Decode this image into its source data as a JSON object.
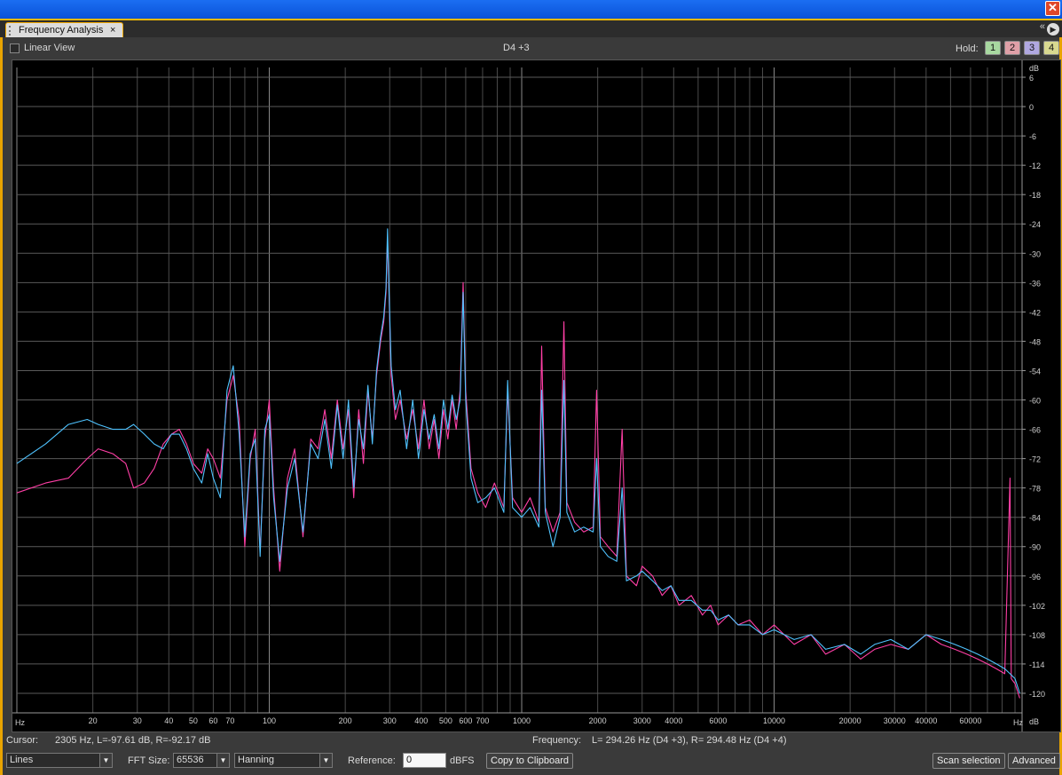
{
  "window": {
    "close_glyph": "✕"
  },
  "tab": {
    "title": "Frequency Analysis",
    "close_glyph": "×",
    "menu_glyph": "▶",
    "overflow_glyph": "«"
  },
  "topbar": {
    "linear_view_label": "Linear View",
    "linear_view_checked": false,
    "note": "D4 +3",
    "hold_label": "Hold:",
    "hold_buttons": [
      {
        "label": "1",
        "color": "#a8d8a0"
      },
      {
        "label": "2",
        "color": "#e0a0a8"
      },
      {
        "label": "3",
        "color": "#b0a8e0"
      },
      {
        "label": "4",
        "color": "#d8d890"
      }
    ]
  },
  "status": {
    "cursor_label": "Cursor:",
    "cursor_value": "2305 Hz, L=-97.61 dB, R=-92.17 dB",
    "frequency_label": "Frequency:",
    "frequency_value": "L= 294.26 Hz (D4 +3), R= 294.48 Hz (D4 +4)"
  },
  "controls": {
    "plot_style": "Lines",
    "fft_size_label": "FFT Size:",
    "fft_size": "65536",
    "window_func": "Hanning",
    "reference_label": "Reference:",
    "reference_value": "0",
    "reference_unit": "dBFS",
    "copy_button": "Copy to Clipboard",
    "scan_button": "Scan selection",
    "advanced_button": "Advanced"
  },
  "chart_data": {
    "type": "line",
    "x_scale": "log",
    "xlim": [
      10,
      96000
    ],
    "ylim": [
      -124,
      8
    ],
    "x_tick_labels": [
      {
        "value": 20,
        "label": "20",
        "major": false
      },
      {
        "value": 30,
        "label": "30",
        "major": false
      },
      {
        "value": 40,
        "label": "40",
        "major": false
      },
      {
        "value": 50,
        "label": "50",
        "major": false
      },
      {
        "value": 60,
        "label": "60",
        "major": false
      },
      {
        "value": 70,
        "label": "70",
        "major": false
      },
      {
        "value": 100,
        "label": "100",
        "major": true
      },
      {
        "value": 200,
        "label": "200",
        "major": false
      },
      {
        "value": 300,
        "label": "300",
        "major": false
      },
      {
        "value": 400,
        "label": "400",
        "major": false
      },
      {
        "value": 500,
        "label": "500",
        "major": false
      },
      {
        "value": 600,
        "label": "600",
        "major": false
      },
      {
        "value": 700,
        "label": "700",
        "major": false
      },
      {
        "value": 1000,
        "label": "1000",
        "major": true
      },
      {
        "value": 2000,
        "label": "2000",
        "major": false
      },
      {
        "value": 3000,
        "label": "3000",
        "major": false
      },
      {
        "value": 4000,
        "label": "4000",
        "major": false
      },
      {
        "value": 6000,
        "label": "6000",
        "major": false
      },
      {
        "value": 10000,
        "label": "10000",
        "major": true
      },
      {
        "value": 20000,
        "label": "20000",
        "major": false
      },
      {
        "value": 30000,
        "label": "30000",
        "major": false
      },
      {
        "value": 40000,
        "label": "40000",
        "major": false
      },
      {
        "value": 60000,
        "label": "60000",
        "major": false
      }
    ],
    "x_unit_left": "Hz",
    "x_unit_right": "Hz",
    "y_unit_top": "dB",
    "y_unit_bottom": "dB",
    "y_ticks": [
      6,
      0,
      -6,
      -12,
      -18,
      -24,
      -30,
      -36,
      -42,
      -48,
      -54,
      -60,
      -66,
      -72,
      -78,
      -84,
      -90,
      -96,
      -102,
      -108,
      -114,
      -120
    ],
    "grid": true,
    "series": [
      {
        "color": "#ff3fa6",
        "points": [
          [
            10,
            -79
          ],
          [
            13,
            -77
          ],
          [
            16,
            -76
          ],
          [
            19,
            -72
          ],
          [
            21,
            -70
          ],
          [
            24,
            -71
          ],
          [
            27,
            -73
          ],
          [
            29,
            -78
          ],
          [
            32,
            -77
          ],
          [
            35,
            -74
          ],
          [
            38,
            -69
          ],
          [
            41,
            -67
          ],
          [
            44,
            -66
          ],
          [
            47,
            -69
          ],
          [
            50,
            -73
          ],
          [
            54,
            -75
          ],
          [
            57,
            -70
          ],
          [
            60,
            -72
          ],
          [
            64,
            -76
          ],
          [
            68,
            -60
          ],
          [
            72,
            -55
          ],
          [
            76,
            -64
          ],
          [
            80,
            -90
          ],
          [
            84,
            -72
          ],
          [
            88,
            -66
          ],
          [
            92,
            -91
          ],
          [
            96,
            -68
          ],
          [
            100,
            -60
          ],
          [
            104,
            -78
          ],
          [
            110,
            -95
          ],
          [
            118,
            -76
          ],
          [
            126,
            -70
          ],
          [
            136,
            -88
          ],
          [
            146,
            -68
          ],
          [
            156,
            -70
          ],
          [
            166,
            -62
          ],
          [
            176,
            -72
          ],
          [
            186,
            -60
          ],
          [
            196,
            -70
          ],
          [
            206,
            -62
          ],
          [
            216,
            -80
          ],
          [
            226,
            -62
          ],
          [
            236,
            -73
          ],
          [
            246,
            -58
          ],
          [
            256,
            -68
          ],
          [
            266,
            -55
          ],
          [
            276,
            -48
          ],
          [
            284,
            -44
          ],
          [
            290,
            -38
          ],
          [
            294,
            -27
          ],
          [
            298,
            -38
          ],
          [
            304,
            -55
          ],
          [
            316,
            -64
          ],
          [
            330,
            -60
          ],
          [
            350,
            -68
          ],
          [
            370,
            -62
          ],
          [
            390,
            -70
          ],
          [
            410,
            -60
          ],
          [
            430,
            -70
          ],
          [
            450,
            -64
          ],
          [
            470,
            -72
          ],
          [
            490,
            -62
          ],
          [
            510,
            -68
          ],
          [
            530,
            -60
          ],
          [
            550,
            -66
          ],
          [
            570,
            -58
          ],
          [
            586,
            -36
          ],
          [
            600,
            -58
          ],
          [
            630,
            -74
          ],
          [
            670,
            -79
          ],
          [
            720,
            -82
          ],
          [
            780,
            -77
          ],
          [
            850,
            -82
          ],
          [
            880,
            -58
          ],
          [
            920,
            -80
          ],
          [
            1000,
            -83
          ],
          [
            1080,
            -80
          ],
          [
            1170,
            -85
          ],
          [
            1200,
            -49
          ],
          [
            1240,
            -82
          ],
          [
            1330,
            -87
          ],
          [
            1420,
            -83
          ],
          [
            1470,
            -44
          ],
          [
            1510,
            -81
          ],
          [
            1620,
            -85
          ],
          [
            1760,
            -87
          ],
          [
            1920,
            -86
          ],
          [
            1980,
            -58
          ],
          [
            2050,
            -88
          ],
          [
            2200,
            -90
          ],
          [
            2380,
            -92
          ],
          [
            2500,
            -66
          ],
          [
            2600,
            -96
          ],
          [
            2850,
            -98
          ],
          [
            3000,
            -94
          ],
          [
            3300,
            -96
          ],
          [
            3600,
            -100
          ],
          [
            3900,
            -98
          ],
          [
            4200,
            -102
          ],
          [
            4700,
            -100
          ],
          [
            5200,
            -104
          ],
          [
            5600,
            -102
          ],
          [
            6000,
            -106
          ],
          [
            6600,
            -104
          ],
          [
            7200,
            -106
          ],
          [
            8000,
            -105
          ],
          [
            9000,
            -108
          ],
          [
            10000,
            -106
          ],
          [
            12000,
            -110
          ],
          [
            14000,
            -108
          ],
          [
            16000,
            -112
          ],
          [
            19000,
            -110
          ],
          [
            22000,
            -113
          ],
          [
            25000,
            -111
          ],
          [
            29000,
            -110
          ],
          [
            34000,
            -111
          ],
          [
            40000,
            -108
          ],
          [
            46000,
            -110
          ],
          [
            52000,
            -111
          ],
          [
            58000,
            -112
          ],
          [
            64000,
            -113
          ],
          [
            70000,
            -114
          ],
          [
            76000,
            -115
          ],
          [
            82000,
            -116
          ],
          [
            86000,
            -76
          ],
          [
            87000,
            -117
          ],
          [
            90000,
            -118
          ],
          [
            94000,
            -121
          ]
        ]
      },
      {
        "color": "#4fc3ff",
        "points": [
          [
            10,
            -73
          ],
          [
            13,
            -69
          ],
          [
            16,
            -65
          ],
          [
            19,
            -64
          ],
          [
            21,
            -65
          ],
          [
            24,
            -66
          ],
          [
            27,
            -66
          ],
          [
            29,
            -65
          ],
          [
            32,
            -67
          ],
          [
            35,
            -69
          ],
          [
            38,
            -70
          ],
          [
            41,
            -67
          ],
          [
            44,
            -67
          ],
          [
            47,
            -70
          ],
          [
            50,
            -74
          ],
          [
            54,
            -77
          ],
          [
            57,
            -71
          ],
          [
            60,
            -76
          ],
          [
            64,
            -80
          ],
          [
            68,
            -58
          ],
          [
            72,
            -53
          ],
          [
            76,
            -67
          ],
          [
            80,
            -88
          ],
          [
            84,
            -71
          ],
          [
            88,
            -68
          ],
          [
            92,
            -92
          ],
          [
            96,
            -66
          ],
          [
            100,
            -63
          ],
          [
            104,
            -80
          ],
          [
            110,
            -93
          ],
          [
            118,
            -78
          ],
          [
            126,
            -72
          ],
          [
            136,
            -87
          ],
          [
            146,
            -69
          ],
          [
            156,
            -72
          ],
          [
            166,
            -64
          ],
          [
            176,
            -74
          ],
          [
            186,
            -61
          ],
          [
            196,
            -72
          ],
          [
            206,
            -60
          ],
          [
            216,
            -78
          ],
          [
            226,
            -64
          ],
          [
            236,
            -70
          ],
          [
            246,
            -57
          ],
          [
            256,
            -69
          ],
          [
            266,
            -54
          ],
          [
            276,
            -47
          ],
          [
            284,
            -43
          ],
          [
            290,
            -37
          ],
          [
            294,
            -25
          ],
          [
            298,
            -37
          ],
          [
            304,
            -53
          ],
          [
            316,
            -62
          ],
          [
            330,
            -58
          ],
          [
            350,
            -70
          ],
          [
            370,
            -60
          ],
          [
            390,
            -72
          ],
          [
            410,
            -62
          ],
          [
            430,
            -68
          ],
          [
            450,
            -63
          ],
          [
            470,
            -70
          ],
          [
            490,
            -60
          ],
          [
            510,
            -66
          ],
          [
            530,
            -59
          ],
          [
            550,
            -64
          ],
          [
            570,
            -60
          ],
          [
            586,
            -38
          ],
          [
            600,
            -60
          ],
          [
            630,
            -76
          ],
          [
            670,
            -81
          ],
          [
            720,
            -80
          ],
          [
            780,
            -78
          ],
          [
            850,
            -83
          ],
          [
            880,
            -56
          ],
          [
            920,
            -82
          ],
          [
            1000,
            -84
          ],
          [
            1080,
            -82
          ],
          [
            1170,
            -86
          ],
          [
            1200,
            -58
          ],
          [
            1240,
            -83
          ],
          [
            1330,
            -90
          ],
          [
            1420,
            -84
          ],
          [
            1470,
            -56
          ],
          [
            1510,
            -83
          ],
          [
            1620,
            -87
          ],
          [
            1760,
            -86
          ],
          [
            1920,
            -87
          ],
          [
            1980,
            -72
          ],
          [
            2050,
            -90
          ],
          [
            2200,
            -92
          ],
          [
            2380,
            -93
          ],
          [
            2500,
            -78
          ],
          [
            2600,
            -97
          ],
          [
            2850,
            -96
          ],
          [
            3000,
            -95
          ],
          [
            3300,
            -97
          ],
          [
            3600,
            -99
          ],
          [
            3900,
            -98
          ],
          [
            4200,
            -101
          ],
          [
            4700,
            -101
          ],
          [
            5200,
            -103
          ],
          [
            5600,
            -103
          ],
          [
            6000,
            -105
          ],
          [
            6600,
            -104
          ],
          [
            7200,
            -106
          ],
          [
            8000,
            -106
          ],
          [
            9000,
            -108
          ],
          [
            10000,
            -107
          ],
          [
            12000,
            -109
          ],
          [
            14000,
            -108
          ],
          [
            16000,
            -111
          ],
          [
            19000,
            -110
          ],
          [
            22000,
            -112
          ],
          [
            25000,
            -110
          ],
          [
            29000,
            -109
          ],
          [
            34000,
            -111
          ],
          [
            40000,
            -108
          ],
          [
            46000,
            -109
          ],
          [
            52000,
            -110
          ],
          [
            58000,
            -111
          ],
          [
            64000,
            -112
          ],
          [
            70000,
            -113
          ],
          [
            76000,
            -114
          ],
          [
            82000,
            -115
          ],
          [
            86000,
            -116
          ],
          [
            90000,
            -117
          ],
          [
            94000,
            -120
          ]
        ]
      }
    ]
  }
}
